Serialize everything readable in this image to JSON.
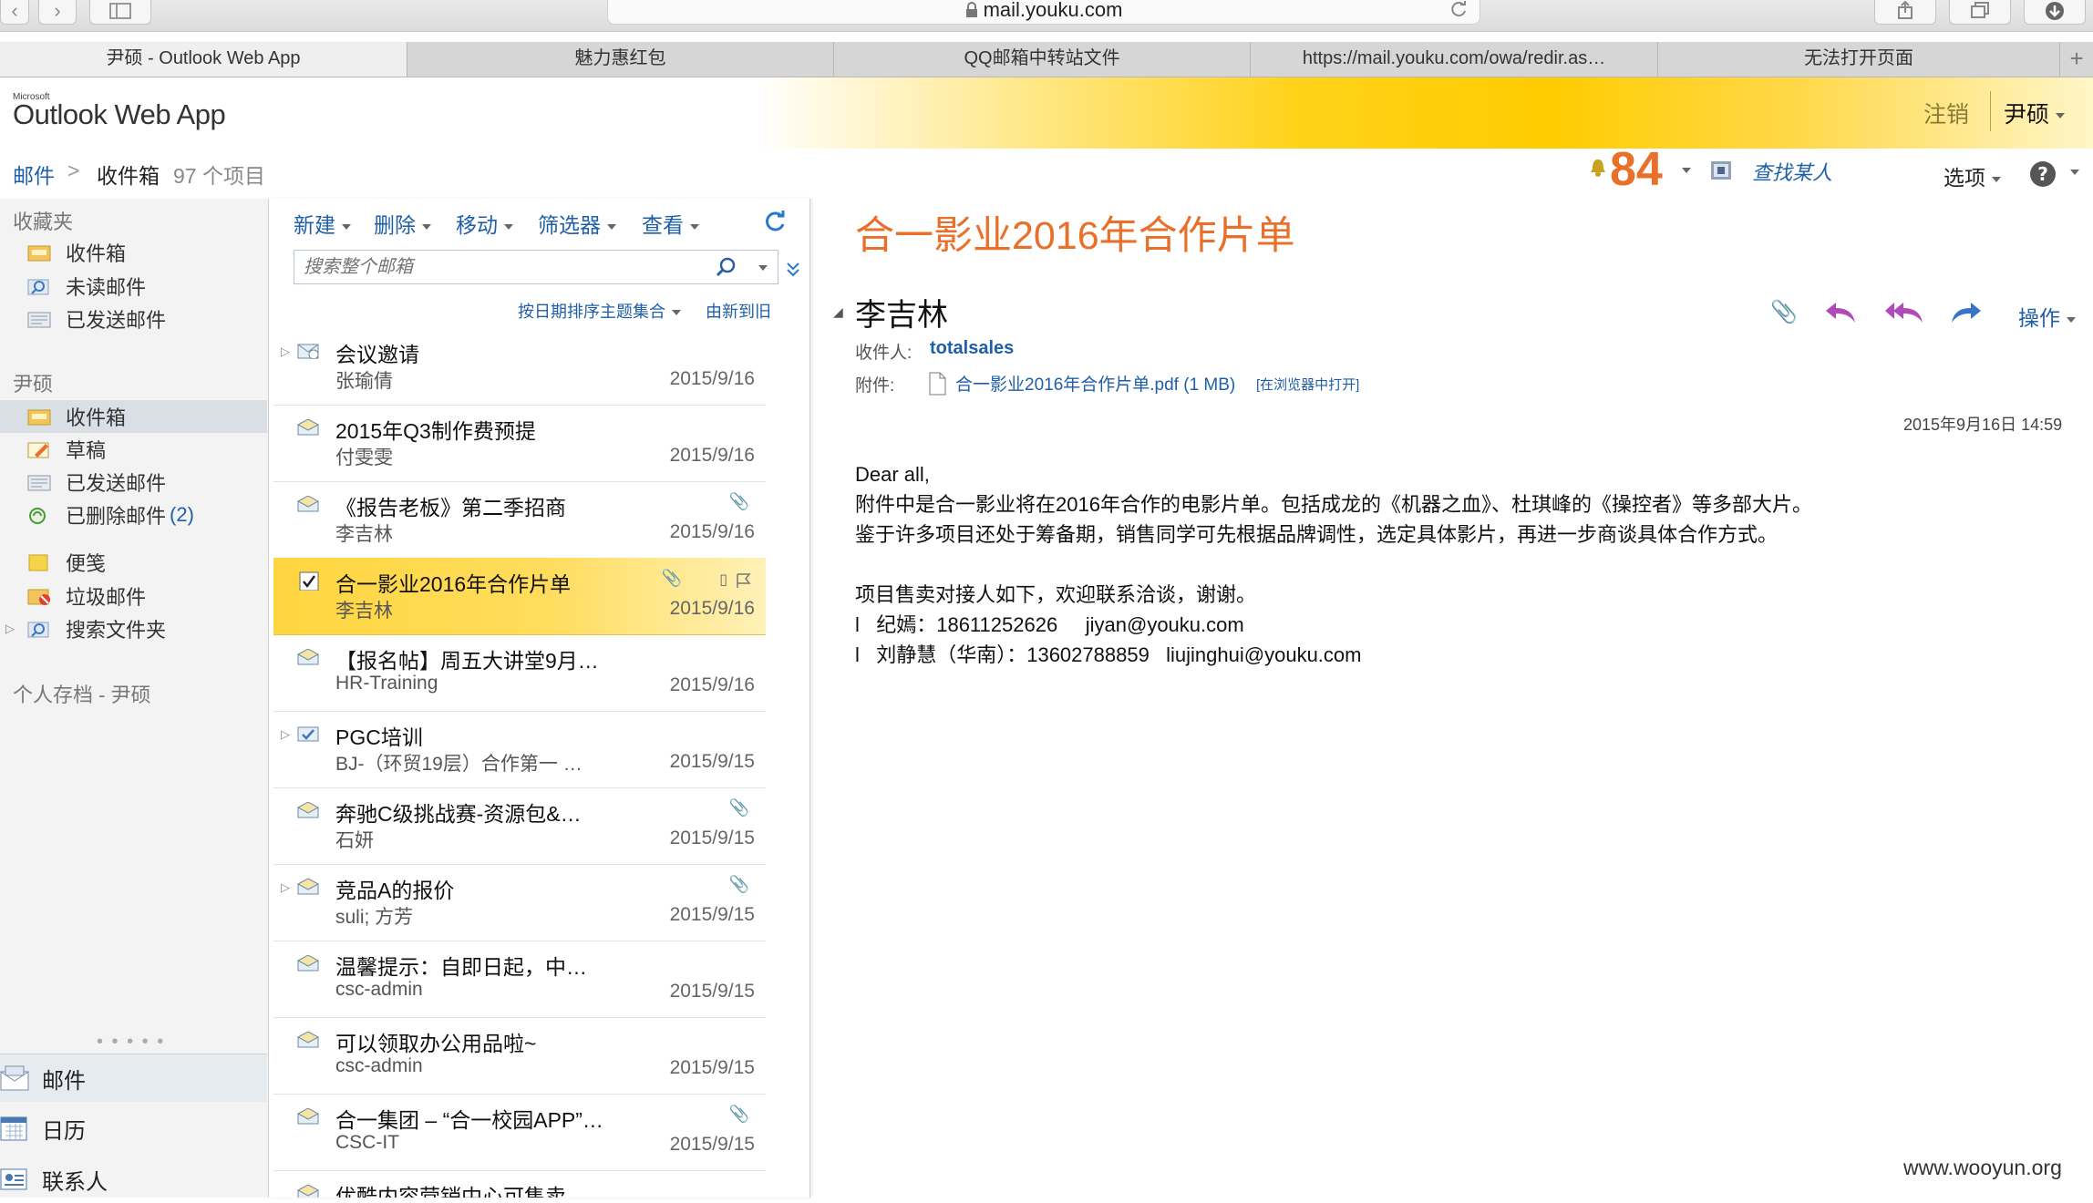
{
  "browser": {
    "url": "mail.youku.com",
    "tabs": [
      {
        "label": "尹硕 - Outlook Web App"
      },
      {
        "label": "魅力惠红包"
      },
      {
        "label": "QQ邮箱中转站文件"
      },
      {
        "label": "https://mail.youku.com/owa/redir.as…"
      },
      {
        "label": "无法打开页面"
      }
    ],
    "new_tab": "+"
  },
  "header": {
    "logo_small": "Microsoft",
    "logo": "Outlook Web App",
    "signout": "注销",
    "user": "尹硕"
  },
  "breadcrumb": {
    "root": "邮件",
    "sep": ">",
    "folder": "收件箱",
    "count": "97 个项目"
  },
  "topright": {
    "badge": "84",
    "find_people": "查找某人",
    "options": "选项"
  },
  "nav": {
    "favorites_header": "收藏夹",
    "favorites": [
      {
        "label": "收件箱"
      },
      {
        "label": "未读邮件"
      },
      {
        "label": "已发送邮件"
      }
    ],
    "mailbox_header": "尹硕",
    "folders": [
      {
        "label": "收件箱"
      },
      {
        "label": "草稿"
      },
      {
        "label": "已发送邮件"
      },
      {
        "label": "已删除邮件",
        "count": "(2)"
      },
      {
        "label": "便笺"
      },
      {
        "label": "垃圾邮件"
      },
      {
        "label": "搜索文件夹"
      }
    ],
    "archive": "个人存档 - 尹硕",
    "bottom": [
      {
        "label": "邮件"
      },
      {
        "label": "日历"
      },
      {
        "label": "联系人"
      }
    ]
  },
  "list": {
    "commands": [
      "新建",
      "删除",
      "移动",
      "筛选器",
      "查看"
    ],
    "search_placeholder": "搜索整个邮箱",
    "sort_label": "按日期排序主题集合",
    "sort_order": "由新到旧",
    "messages": [
      {
        "subject": "会议邀请",
        "from": "张瑜倩",
        "date": "2015/9/16"
      },
      {
        "subject": "2015年Q3制作费预提",
        "from": "付雯雯",
        "date": "2015/9/16"
      },
      {
        "subject": "《报告老板》第二季招商",
        "from": "李吉林",
        "date": "2015/9/16"
      },
      {
        "subject": "合一影业2016年合作片单",
        "from": "李吉林",
        "date": "2015/9/16"
      },
      {
        "subject": "【报名帖】周五大讲堂9月…",
        "from": "HR-Training",
        "date": "2015/9/16"
      },
      {
        "subject": "PGC培训",
        "from": "BJ-（环贸19层）合作第一 …",
        "date": "2015/9/15"
      },
      {
        "subject": "奔驰C级挑战赛-资源包&…",
        "from": "石妍",
        "date": "2015/9/15"
      },
      {
        "subject": "竞品A的报价",
        "from": "suli; 方芳",
        "date": "2015/9/15"
      },
      {
        "subject": "温馨提示：自即日起，中…",
        "from": "csc-admin",
        "date": "2015/9/15"
      },
      {
        "subject": "可以领取办公用品啦~",
        "from": "csc-admin",
        "date": "2015/9/15"
      },
      {
        "subject": "合一集团 – “合一校园APP”…",
        "from": "CSC-IT",
        "date": "2015/9/15"
      },
      {
        "subject": "优酷内容营销中心可售卖",
        "from": "",
        "date": ""
      }
    ]
  },
  "reading": {
    "title": "合一影业2016年合作片单",
    "sender": "李吉林",
    "actions_label": "操作",
    "to_label": "收件人:",
    "to_value": "totalsales",
    "attach_label": "附件:",
    "attach_file": "合一影业2016年合作片单.pdf (1 MB)",
    "attach_open": "[在浏览器中打开]",
    "date": "2015年9月16日 14:59",
    "body": [
      "Dear all,",
      "附件中是合一影业将在2016年合作的电影片单。包括成龙的《机器之血》、杜琪峰的《操控者》等多部大片。",
      "鉴于许多项目还处于筹备期，销售同学可先根据品牌调性，选定具体影片，再进一步商谈具体合作方式。",
      "",
      "项目售卖对接人如下，欢迎联系洽谈，谢谢。",
      "l   纪嫣：18611252626     jiyan@youku.com",
      "l   刘静慧（华南）：13602788859   liujinghui@youku.com"
    ]
  },
  "watermark": "www.wooyun.org",
  "colors": {
    "accent_orange": "#e8702a",
    "link_blue": "#1f5fa7",
    "selected_row": "#ffd84a",
    "reply_purple": "#b04ab8",
    "forward_blue": "#3a73c6"
  }
}
